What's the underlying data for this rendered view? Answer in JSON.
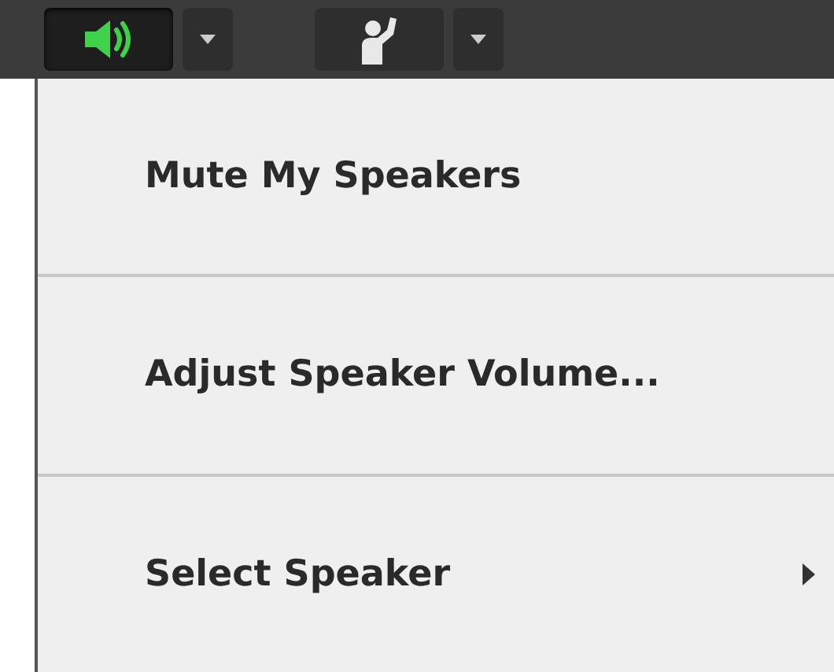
{
  "toolbar": {
    "buttons": [
      {
        "kind": "speaker",
        "on": true
      },
      {
        "kind": "hand",
        "on": false
      }
    ]
  },
  "menu": {
    "items": [
      {
        "label": "Mute My Speakers",
        "has_submenu": false
      },
      {
        "label": "Adjust Speaker Volume...",
        "has_submenu": false
      },
      {
        "label": "Select Speaker",
        "has_submenu": true
      }
    ]
  }
}
